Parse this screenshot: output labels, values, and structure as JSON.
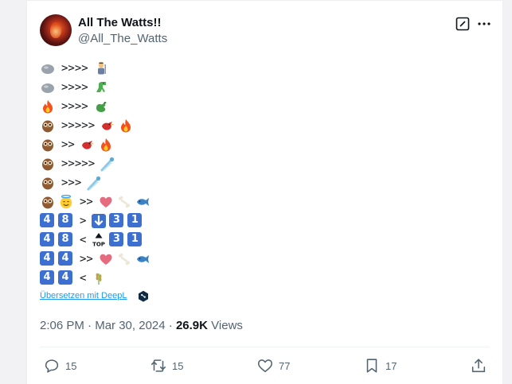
{
  "author": {
    "display_name": "All The Watts!!",
    "handle": "@All_The_Watts"
  },
  "tweet_lines": [
    {
      "emojis_before": [
        "rock"
      ],
      "text": ">>>>",
      "emojis_after": [
        "person-warrior"
      ]
    },
    {
      "emojis_before": [
        "rock"
      ],
      "text": ">>>>",
      "emojis_after": [
        "t-rex"
      ]
    },
    {
      "emojis_before": [
        "fire"
      ],
      "text": ">>>>",
      "emojis_after": [
        "dragon"
      ]
    },
    {
      "emojis_before": [
        "owl"
      ],
      "text": ">>>>>",
      "emojis_after": [
        "bird-red",
        "fire"
      ]
    },
    {
      "emojis_before": [
        "owl"
      ],
      "text": ">>",
      "emojis_after": [
        "bird-red",
        "fire"
      ]
    },
    {
      "emojis_before": [
        "owl"
      ],
      "text": ">>>>>",
      "emojis_after": [
        "comet"
      ]
    },
    {
      "emojis_before": [
        "owl"
      ],
      "text": ">>>",
      "emojis_after": [
        "comet"
      ]
    },
    {
      "emojis_before": [
        "owl",
        "halo-smile"
      ],
      "text": ">>",
      "emojis_after": [
        "heart",
        "bone",
        "fish"
      ]
    },
    {
      "emojis_before": [
        "key-4",
        "key-8"
      ],
      "text": ">",
      "emojis_after": [
        "arrow-down",
        "key-3",
        "key-1"
      ]
    },
    {
      "emojis_before": [
        "key-4",
        "key-8"
      ],
      "text": "<",
      "emojis_after": [
        "top-arrow",
        "key-3",
        "key-1"
      ]
    },
    {
      "emojis_before": [
        "key-4",
        "key-4"
      ],
      "text": ">>",
      "emojis_after": [
        "heart",
        "bone",
        "fish"
      ]
    },
    {
      "emojis_before": [
        "key-4",
        "key-4"
      ],
      "text": "<",
      "emojis_after": [
        "grain"
      ]
    }
  ],
  "keycap_digits": {
    "key-4": "4",
    "key-8": "8",
    "key-3": "3",
    "key-1": "1"
  },
  "top_label": "TOP",
  "translate_link": "Übersetzen mit DeepL",
  "meta": {
    "time": "2:06 PM",
    "date": "Mar 30, 2024",
    "views_count": "26.9K",
    "views_label": "Views",
    "sep": "·"
  },
  "actions": {
    "replies": "15",
    "reposts": "15",
    "likes": "77",
    "bookmarks": "17"
  },
  "colors": {
    "text": "#0f1419",
    "muted": "#536471",
    "link": "#1d9bf0",
    "keycap": "#3d6fd1"
  }
}
